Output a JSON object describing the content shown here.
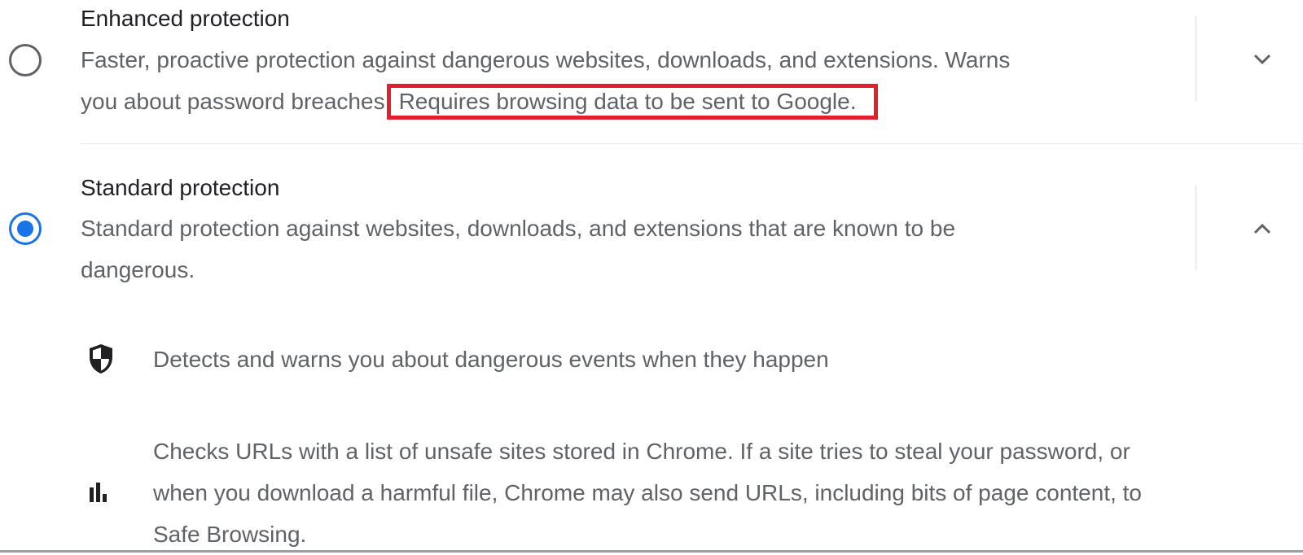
{
  "options": [
    {
      "title": "Enhanced protection",
      "desc_line1": "Faster, proactive protection against dangerous websites, downloads, and extensions. Warns",
      "desc_line2_prefix": "you about password breaches",
      "desc_line2_highlight": "Requires browsing data to be sent to Google.",
      "selected": false,
      "expand_icon": "chevron-down-icon"
    },
    {
      "title": "Standard protection",
      "desc_line1": "Standard protection against websites, downloads, and extensions that are known to be",
      "desc_line2": "dangerous.",
      "selected": true,
      "expand_icon": "chevron-up-icon"
    }
  ],
  "standard_details": [
    {
      "icon": "shield-icon",
      "text": "Detects and warns you about dangerous events when they happen"
    },
    {
      "icon": "bar-chart-icon",
      "line1": "Checks URLs with a list of unsafe sites stored in Chrome. If a site tries to steal your password, or",
      "line2": "when you download a harmful file, Chrome may also send URLs, including bits of page content, to",
      "line3": "Safe Browsing."
    }
  ],
  "colors": {
    "accent": "#1a73e8",
    "highlight_border": "#e1202e",
    "text_primary": "#202124",
    "text_secondary": "#5f6368"
  }
}
